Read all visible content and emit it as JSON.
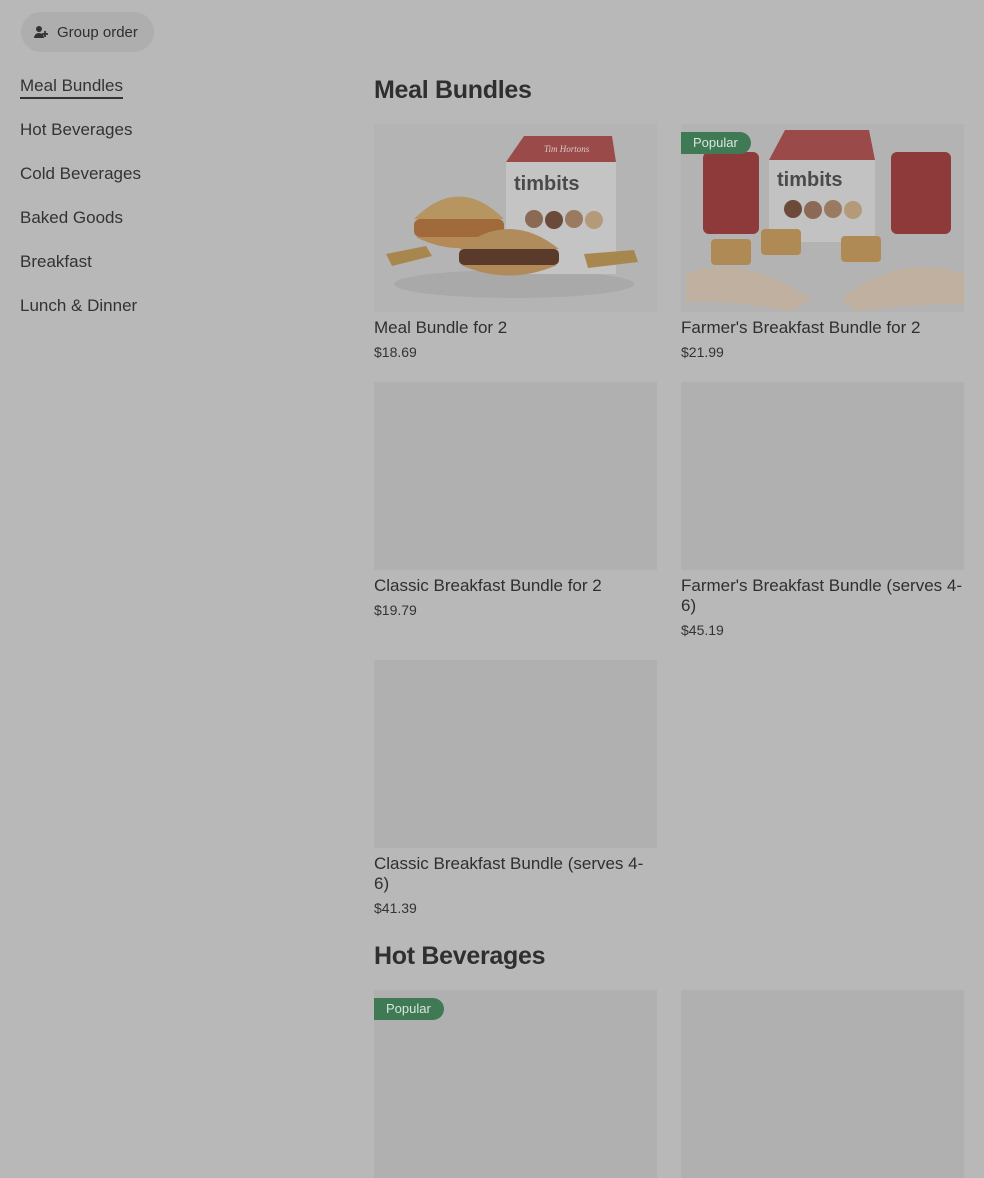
{
  "header": {
    "group_order_label": "Group order"
  },
  "sidebar": {
    "items": [
      {
        "label": "Meal Bundles"
      },
      {
        "label": "Hot Beverages"
      },
      {
        "label": "Cold Beverages"
      },
      {
        "label": "Baked Goods"
      },
      {
        "label": "Breakfast"
      },
      {
        "label": "Lunch & Dinner"
      }
    ]
  },
  "sections": [
    {
      "title": "Meal Bundles",
      "items": [
        {
          "name": "Meal Bundle for 2",
          "price": "$18.69"
        },
        {
          "name": "Farmer's Breakfast Bundle for 2",
          "price": "$21.99",
          "badge": "Popular"
        },
        {
          "name": "Classic Breakfast Bundle for 2",
          "price": "$19.79"
        },
        {
          "name": "Farmer's Breakfast Bundle (serves 4-6)",
          "price": "$45.19"
        },
        {
          "name": "Classic Breakfast Bundle (serves 4-6)",
          "price": "$41.39"
        }
      ]
    },
    {
      "title": "Hot Beverages",
      "items": [
        {
          "badge": "Popular"
        }
      ]
    }
  ],
  "packaging_text": {
    "brand": "timbits",
    "logo": "Tim Hortons"
  }
}
